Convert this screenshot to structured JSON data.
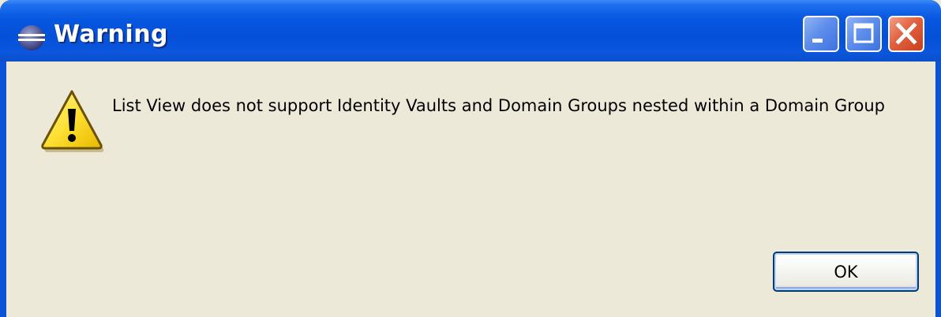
{
  "window": {
    "title": "Warning",
    "icon": "eclipse-app-icon"
  },
  "title_buttons": {
    "minimize": "minimize-icon",
    "maximize": "maximize-icon",
    "close": "close-icon"
  },
  "dialog": {
    "icon": "warning-icon",
    "message": "List View does not support Identity Vaults and Domain Groups nested within a Domain Group",
    "ok_label": "OK"
  },
  "colors": {
    "titlebar": "#0550D8",
    "body": "#ECE9D8",
    "close_button": "#E2603F",
    "warning_yellow": "#FFE033"
  }
}
